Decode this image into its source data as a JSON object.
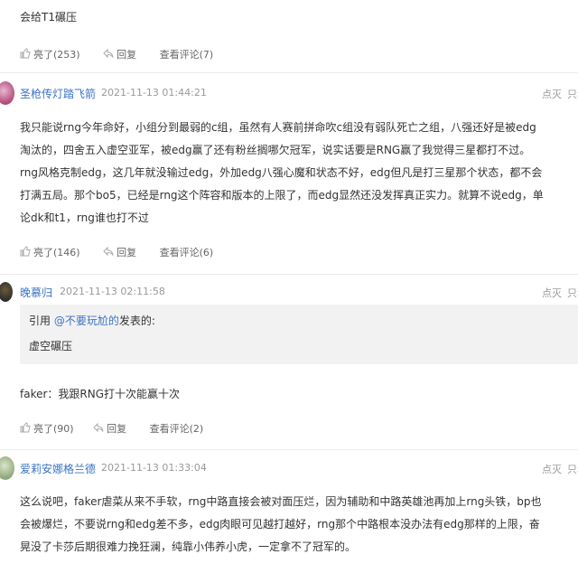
{
  "top_comment": {
    "text": "会给T1碾压",
    "actions": {
      "like": "亮了(253)",
      "reply": "回复",
      "view": "查看评论(7)"
    }
  },
  "comment1": {
    "username": "圣枪传灯踏飞箭",
    "time": "2021-11-13 01:44:21",
    "right": {
      "dislike": "点灭",
      "more": "只看"
    },
    "lines": [
      "我只能说rng今年命好，小组分到最弱的c组，虽然有人赛前拼命吹c组没有弱队死亡之组，八强还好是被edg",
      "淘汰的，四舍五入虚空亚军，被edg赢了还有粉丝搁哪欠冠军，说实话要是RNG赢了我觉得三星都打不过。",
      "rng风格克制edg，这几年就没输过edg，外加edg八强心魔和状态不好，edg但凡是打三星那个状态，都不会",
      "打满五局。那个bo5，已经是rng这个阵容和版本的上限了，而edg显然还没发挥真正实力。就算不说edg，单",
      "论dk和t1，rng谁也打不过"
    ],
    "actions": {
      "like": "亮了(146)",
      "reply": "回复",
      "view": "查看评论(6)"
    }
  },
  "comment2": {
    "username": "晚慕归",
    "time": "2021-11-13 02:11:58",
    "right": {
      "dislike": "点灭",
      "more": "只看"
    },
    "quote": {
      "prefix": "引用 ",
      "user": "@不要玩尬的",
      "suffix": "发表的:",
      "text": "虚空碾压"
    },
    "text": "faker：我跟RNG打十次能赢十次",
    "actions": {
      "like": "亮了(90)",
      "reply": "回复",
      "view": "查看评论(2)"
    }
  },
  "comment3": {
    "username": "爱莉安娜格兰德",
    "time": "2021-11-13 01:33:04",
    "right": {
      "dislike": "点灭",
      "more": "只看"
    },
    "lines": [
      "这么说吧，faker虐菜从来不手软，rng中路直接会被对面压烂，因为辅助和中路英雄池再加上rng头铁，bp也",
      "会被爆烂，不要说rng和edg差不多，edg肉眼可见越打越好，rng那个中路根本没办法有edg那样的上限，奋",
      "晃没了卡莎后期很难力挽狂澜，纯靠小伟养小虎，一定拿不了冠军的。"
    ]
  }
}
